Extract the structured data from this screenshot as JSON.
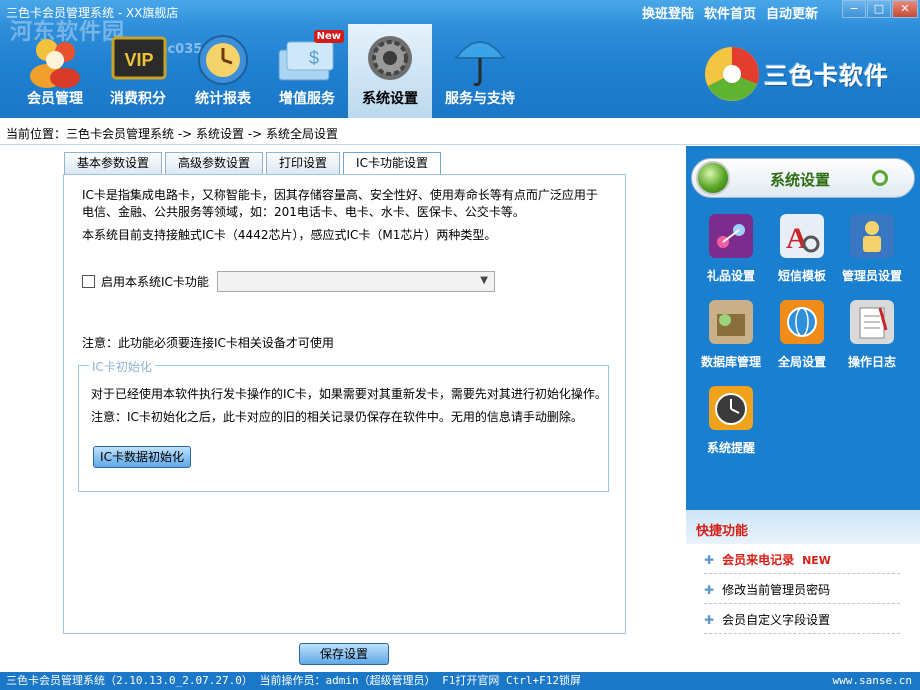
{
  "window": {
    "title": "三色卡会员管理系统 - XX旗舰店",
    "top_links": [
      "换班登陆",
      "软件首页",
      "自动更新"
    ],
    "controls": [
      "−",
      "□",
      "✕"
    ],
    "watermark": "河东软件园",
    "watermark_url": "www.pc0359.cn"
  },
  "nav": [
    {
      "label": "会员管理",
      "icon": "members-icon"
    },
    {
      "label": "消费积分",
      "icon": "vip-icon"
    },
    {
      "label": "统计报表",
      "icon": "clock-icon"
    },
    {
      "label": "增值服务",
      "icon": "value-service-icon",
      "badge": "New"
    },
    {
      "label": "系统设置",
      "icon": "gear-icon",
      "active": true
    },
    {
      "label": "服务与支持",
      "icon": "umbrella-icon"
    }
  ],
  "brand": {
    "name": "三色卡软件"
  },
  "breadcrumb": "当前位置：三色卡会员管理系统 -> 系统设置 -> 系统全局设置",
  "tabs": [
    "基本参数设置",
    "高级参数设置",
    "打印设置",
    "IC卡功能设置"
  ],
  "active_tab": "IC卡功能设置",
  "ic_panel": {
    "intro_line1": "IC卡是指集成电路卡，又称智能卡，因其存储容量高、安全性好、使用寿命长等有点而广泛应用于",
    "intro_line2": "电信、金融、公共服务等领域，如：201电话卡、电卡、水卡、医保卡、公交卡等。",
    "support_text": "本系统目前支持接触式IC卡（4442芯片），感应式IC卡（M1芯片）两种类型。",
    "enable_label": "启用本系统IC卡功能",
    "enable_checked": false,
    "select_value": "",
    "notice": "注意：此功能必须要连接IC卡相关设备才可使用",
    "init_group": {
      "legend": "IC卡初始化",
      "line1": "对于已经使用本软件执行发卡操作的IC卡，如果需要对其重新发卡，需要先对其进行初始化操作。",
      "line2": "注意：IC卡初始化之后，此卡对应的旧的相关记录仍保存在软件中。无用的信息请手动删除。",
      "button": "IC卡数据初始化"
    }
  },
  "save_button": "保存设置",
  "sidebar": {
    "title": "系统设置",
    "tools": [
      {
        "label": "礼品设置",
        "icon": "gift-icon",
        "color": "#7b2c8c"
      },
      {
        "label": "短信模板",
        "icon": "sms-template-icon",
        "color": "#c8262b"
      },
      {
        "label": "管理员设置",
        "icon": "admin-icon",
        "color": "#3a77c2"
      },
      {
        "label": "数据库管理",
        "icon": "database-icon",
        "color": "#8a6f3c"
      },
      {
        "label": "全局设置",
        "icon": "globe-icon",
        "color": "#f08c1a"
      },
      {
        "label": "操作日志",
        "icon": "log-icon",
        "color": "#d9d9d9"
      },
      {
        "label": "系统提醒",
        "icon": "alarm-clock-icon",
        "color": "#f0a21a"
      }
    ]
  },
  "quick": {
    "title": "快捷功能",
    "items": [
      {
        "label": "会员来电记录",
        "badge": "NEW",
        "highlight": true
      },
      {
        "label": "修改当前管理员密码"
      },
      {
        "label": "会员自定义字段设置"
      }
    ]
  },
  "status": {
    "text": "三色卡会员管理系统（2.10.13.0_2.07.27.0） 当前操作员：admin（超级管理员） F1打开官网 Ctrl+F12锁屏",
    "url": "www.sanse.cn"
  }
}
